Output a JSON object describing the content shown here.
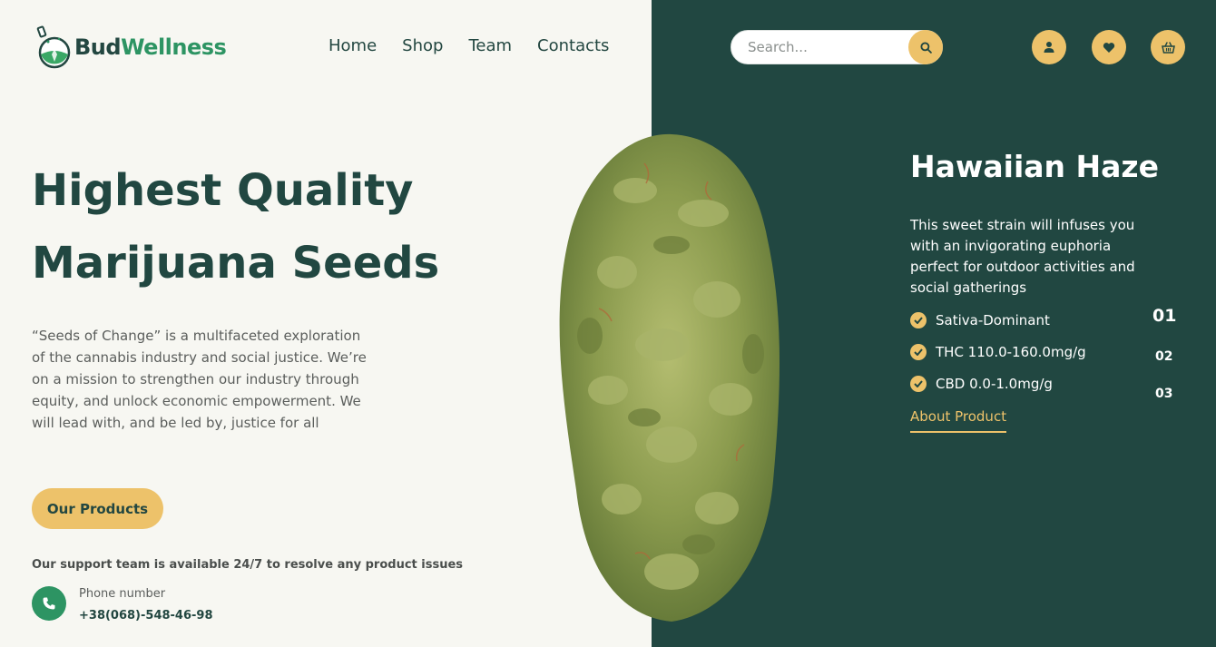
{
  "brand": {
    "part1": "Bud",
    "part2": "Wellness"
  },
  "nav": {
    "items": [
      {
        "label": "Home"
      },
      {
        "label": "Shop"
      },
      {
        "label": "Team"
      },
      {
        "label": "Contacts"
      }
    ]
  },
  "search": {
    "placeholder": "Search...",
    "icon": "search-icon"
  },
  "header_icons": [
    "user-icon",
    "heart-icon",
    "basket-icon"
  ],
  "hero": {
    "title_line1": "Highest Quality",
    "title_line2": "Marijuana Seeds",
    "description": "“Seeds of Change” is a multifaceted exploration of the cannabis industry and social justice. We’re on a mission to strengthen our industry through equity, and unlock economic empowerment. We will lead with, and be led by, justice for all",
    "cta_label": "Our Products",
    "support_text": "Our support team is available 24/7 to resolve any product issues",
    "phone_label": "Phone number",
    "phone_number": "+38(068)-548-46-98"
  },
  "product": {
    "name": "Hawaiian Haze",
    "description": "This sweet strain will infuses you with an invigorating euphoria perfect for outdoor activities and social gatherings",
    "features": [
      "Sativa-Dominant",
      "THC 110.0-160.0mg/g",
      "CBD 0.0-1.0mg/g"
    ],
    "link_label": "About Product"
  },
  "slider": {
    "steps": [
      "01",
      "02",
      "03"
    ],
    "active": "01"
  },
  "colors": {
    "dark_green": "#214741",
    "accent_yellow": "#edc26a",
    "brand_green": "#2d9463",
    "background": "#f7f7f2"
  }
}
